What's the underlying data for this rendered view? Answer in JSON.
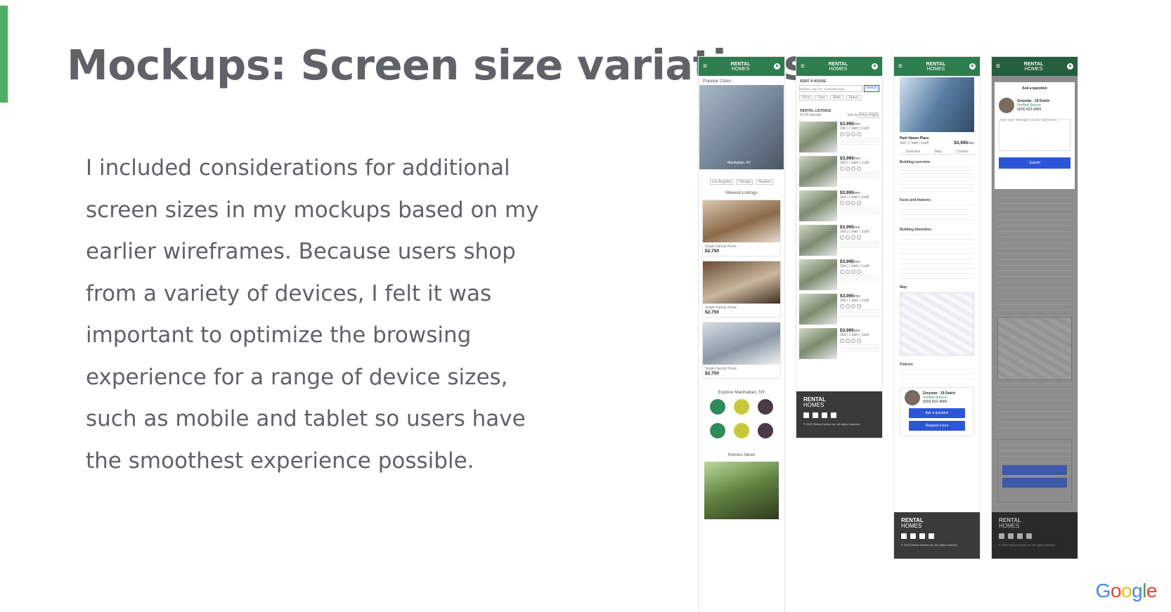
{
  "slide": {
    "title": "Mockups: Screen size variations",
    "body": "I included considerations for additional screen sizes in my mockups based on my earlier wireframes. Because users shop from a variety of devices, I felt it was important to optimize the browsing experience for a range of device sizes, such as mobile and tablet so users have the smoothest experience possible.",
    "accent_color": "#4caf64",
    "logo": "Google"
  },
  "mockup_brand": {
    "line1": "RENTAL",
    "line2": "HOMES"
  },
  "mockup1": {
    "popular_cities": "Popular Cities",
    "city_caption": "Manhattan, NY",
    "city_chips": [
      "Los Angeles",
      "Chicago",
      "Houston"
    ],
    "newest_listings": "Newest Listings",
    "listing_type": "Single-Family Home",
    "listing_price": "$2,750",
    "explore": "Explore Manhattan, NY",
    "homes_news": "Homes News"
  },
  "mockup2": {
    "section": "RENT A HOUSE",
    "search_placeholder": "Address, City, ZIP, or Neighborhood",
    "search_btn": "Search",
    "filters": [
      "Price",
      "Type",
      "Beds",
      "Specs"
    ],
    "listings_header": "RENTAL LISTINGS",
    "results": "9,576 Results",
    "sort_label": "Sort by",
    "sort_value": "Price (high)",
    "row_price": "$3,995",
    "row_unit": "/mo",
    "row_specs": "2bd | 1 bath | 1sqft",
    "copyright": "© 2022 Rental Homes Inc. All rights reserved."
  },
  "mockup3": {
    "property_name": "Park Haven Place",
    "price": "$3,995",
    "price_unit": "/mo",
    "specs": "2bd | 1 bath | 1sqft",
    "tabs": [
      "Overview",
      "Map",
      "Contact"
    ],
    "overview_heading": "Building overview",
    "facts_heading": "Facts and features",
    "amenities_heading": "Building Amenities",
    "map_heading": "Map",
    "policies_heading": "Policies",
    "agent_name": "Greystar - 19 Dutch",
    "agent_badge": "Verified Source",
    "agent_phone": "(929) 822-4969",
    "ask_btn": "Ask a question",
    "tour_btn": "Request a tour"
  },
  "mockup4": {
    "modal_title": "Ask a question",
    "placeholder": "Type your message to ask questions...",
    "submit": "Submit"
  }
}
